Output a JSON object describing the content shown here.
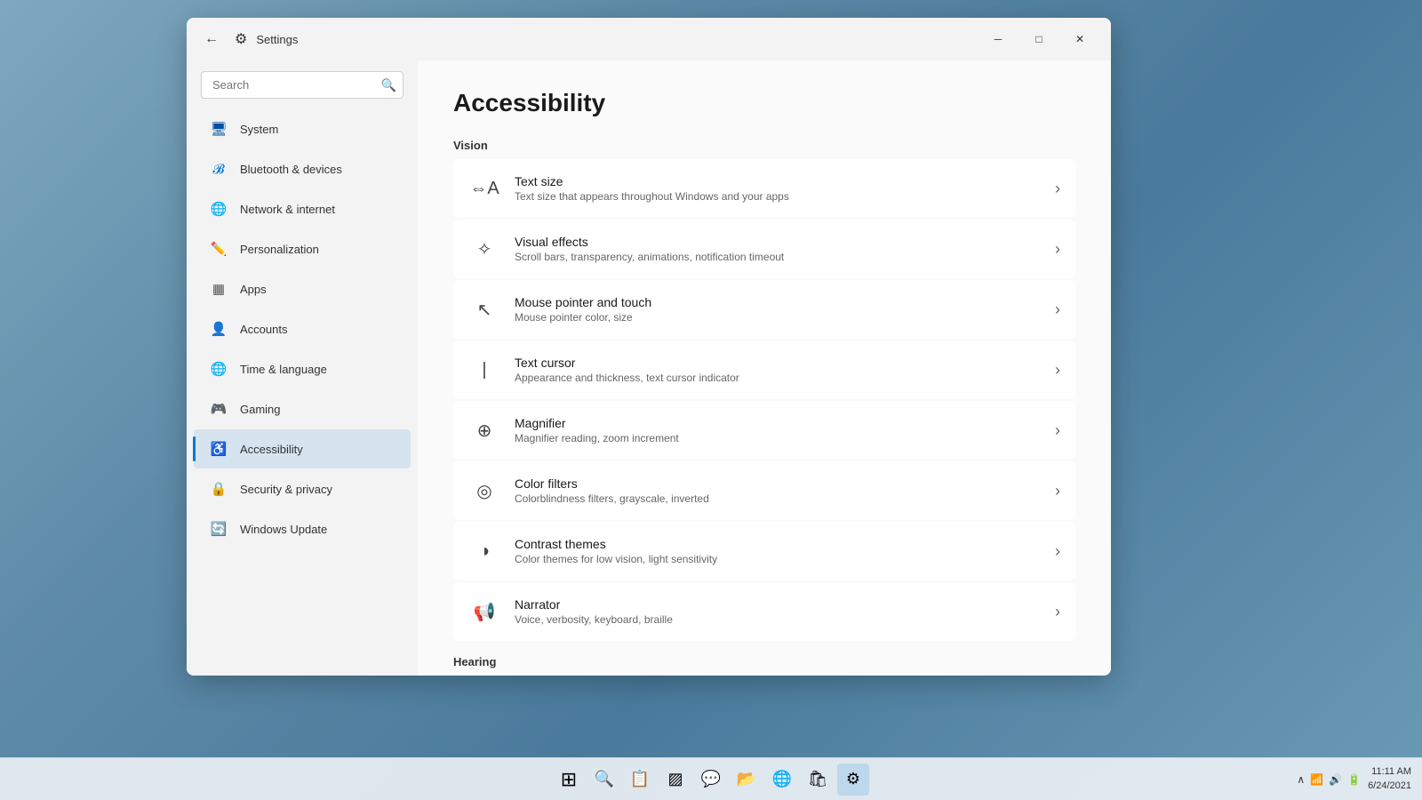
{
  "window": {
    "title": "Settings",
    "page_title": "Accessibility"
  },
  "titlebar": {
    "back_label": "←",
    "minimize_label": "─",
    "maximize_label": "□",
    "close_label": "✕"
  },
  "sidebar": {
    "search_placeholder": "Search",
    "items": [
      {
        "id": "system",
        "label": "System",
        "icon": "🖥",
        "active": false
      },
      {
        "id": "bluetooth",
        "label": "Bluetooth & devices",
        "icon": "⬡",
        "active": false
      },
      {
        "id": "network",
        "label": "Network & internet",
        "icon": "◈",
        "active": false
      },
      {
        "id": "personalization",
        "label": "Personalization",
        "icon": "🖊",
        "active": false
      },
      {
        "id": "apps",
        "label": "Apps",
        "icon": "▦",
        "active": false
      },
      {
        "id": "accounts",
        "label": "Accounts",
        "icon": "●",
        "active": false
      },
      {
        "id": "time",
        "label": "Time & language",
        "icon": "⏱",
        "active": false
      },
      {
        "id": "gaming",
        "label": "Gaming",
        "icon": "◌",
        "active": false
      },
      {
        "id": "accessibility",
        "label": "Accessibility",
        "icon": "♿",
        "active": true
      },
      {
        "id": "security",
        "label": "Security & privacy",
        "icon": "◑",
        "active": false
      },
      {
        "id": "update",
        "label": "Windows Update",
        "icon": "⟳",
        "active": false
      }
    ]
  },
  "content": {
    "vision_section": "Vision",
    "hearing_section": "Hearing",
    "items": [
      {
        "id": "text-size",
        "title": "Text size",
        "subtitle": "Text size that appears throughout Windows and your apps",
        "icon": "𝐀𝐀"
      },
      {
        "id": "visual-effects",
        "title": "Visual effects",
        "subtitle": "Scroll bars, transparency, animations, notification timeout",
        "icon": "✦"
      },
      {
        "id": "mouse-pointer",
        "title": "Mouse pointer and touch",
        "subtitle": "Mouse pointer color, size",
        "icon": "↖"
      },
      {
        "id": "text-cursor",
        "title": "Text cursor",
        "subtitle": "Appearance and thickness, text cursor indicator",
        "icon": "𝐈"
      },
      {
        "id": "magnifier",
        "title": "Magnifier",
        "subtitle": "Magnifier reading, zoom increment",
        "icon": "🔍"
      },
      {
        "id": "color-filters",
        "title": "Color filters",
        "subtitle": "Colorblindness filters, grayscale, inverted",
        "icon": "🎨"
      },
      {
        "id": "contrast-themes",
        "title": "Contrast themes",
        "subtitle": "Color themes for low vision, light sensitivity",
        "icon": "◑"
      },
      {
        "id": "narrator",
        "title": "Narrator",
        "subtitle": "Voice, verbosity, keyboard, braille",
        "icon": "🔊"
      }
    ]
  },
  "taskbar": {
    "time": "11:11 AM",
    "date": "6/24/2021",
    "icons": [
      "⊞",
      "🔍",
      "📁",
      "▨",
      "💬",
      "📂",
      "🌐",
      "🛍",
      "⚙"
    ]
  }
}
